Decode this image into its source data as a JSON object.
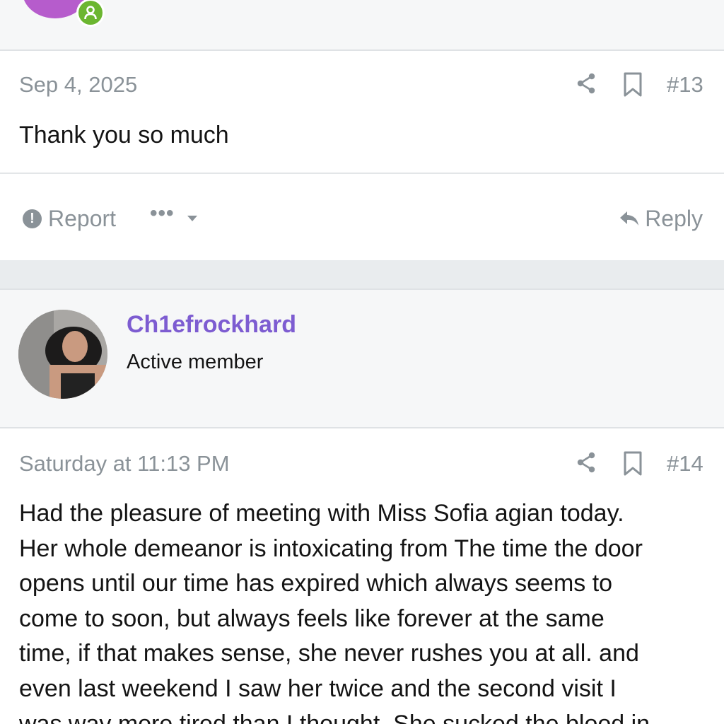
{
  "previous_post": {
    "user_online_badge_icon": "user-online-icon",
    "date": "Sep 4, 2025",
    "number": "#13",
    "body": "Thank you so much",
    "actions": {
      "report_label": "Report",
      "more_label": "•••",
      "reply_label": "Reply"
    },
    "icons": {
      "share": "share-icon",
      "bookmark": "bookmark-icon",
      "report": "report-icon",
      "reply": "reply-icon"
    }
  },
  "current_post": {
    "author": {
      "username": "Ch1efrockhard",
      "title": "Active member"
    },
    "date": "Saturday at 11:13 PM",
    "number": "#14",
    "body_lines": [
      "Had the pleasure of meeting with Miss Sofia agian today.",
      "Her whole demeanor is intoxicating from The time the door",
      "opens until our time has expired which always seems to",
      "come to soon, but always feels like forever at the same",
      "time, if that makes sense, she never rushes you at all. and",
      "even last weekend I saw her twice and the second visit I",
      "was way more tired than I thought. She sucked the blood in"
    ]
  },
  "colors": {
    "username": "#7d5cd1",
    "muted_text": "#8a9298",
    "online_badge": "#6bb630",
    "previous_avatar": "#b65ccc"
  }
}
